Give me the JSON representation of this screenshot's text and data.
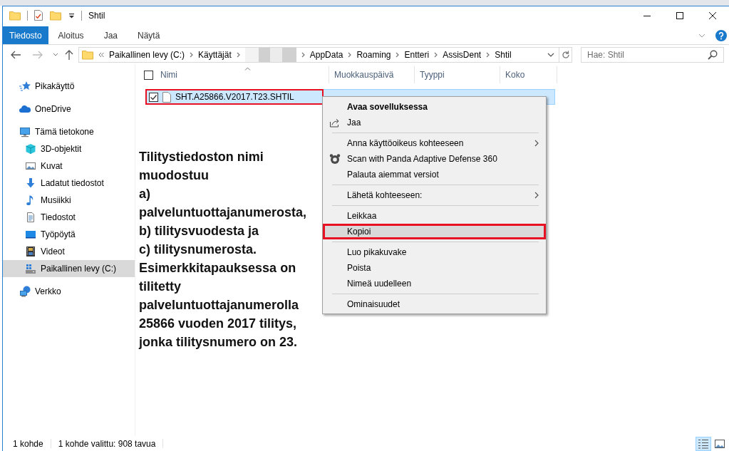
{
  "window": {
    "title": "Shtil"
  },
  "ribbon_tabs": [
    {
      "label": "Tiedosto",
      "kind": "file"
    },
    {
      "label": "Aloitus",
      "kind": "tab"
    },
    {
      "label": "Jaa",
      "kind": "tab"
    },
    {
      "label": "Näytä",
      "kind": "tab"
    }
  ],
  "address_bar": {
    "crumbs": [
      {
        "kind": "text",
        "label": "Paikallinen levy (C:)"
      },
      {
        "kind": "text",
        "label": "Käyttäjät"
      },
      {
        "kind": "redacted"
      },
      {
        "kind": "text",
        "label": "AppData"
      },
      {
        "kind": "text",
        "label": "Roaming"
      },
      {
        "kind": "text",
        "label": "Entteri"
      },
      {
        "kind": "text",
        "label": "AssisDent"
      },
      {
        "kind": "text",
        "label": "Shtil"
      }
    ]
  },
  "search": {
    "placeholder": "Hae: Shtil"
  },
  "sidebar": {
    "items": [
      {
        "label": "Pikakäyttö",
        "kind": "quick-access",
        "selected": false
      },
      {
        "label": "OneDrive",
        "kind": "cloud",
        "selected": false
      },
      {
        "label": "Tämä tietokone",
        "kind": "computer",
        "selected": false,
        "children": [
          {
            "label": "3D-objektit",
            "kind": "objects",
            "selected": false
          },
          {
            "label": "Kuvat",
            "kind": "pictures",
            "selected": false
          },
          {
            "label": "Ladatut tiedostot",
            "kind": "downloads",
            "selected": false
          },
          {
            "label": "Musiikki",
            "kind": "music",
            "selected": false
          },
          {
            "label": "Tiedostot",
            "kind": "documents",
            "selected": false
          },
          {
            "label": "Työpöytä",
            "kind": "desktop",
            "selected": false
          },
          {
            "label": "Videot",
            "kind": "videos",
            "selected": false
          },
          {
            "label": "Paikallinen levy (C:)",
            "kind": "drive",
            "selected": true
          }
        ]
      },
      {
        "label": "Verkko",
        "kind": "network",
        "selected": false
      }
    ]
  },
  "file_list": {
    "header_checked": false,
    "columns": [
      {
        "label": "Nimi",
        "sorted": true
      },
      {
        "label": "Muokkauspäivä",
        "sorted": false
      },
      {
        "label": "Tyyppi",
        "sorted": false
      },
      {
        "label": "Koko",
        "sorted": false
      }
    ],
    "rows": [
      {
        "name": "SHT.A25866.V2017.T23.SHTIL",
        "checked": true,
        "selected": true,
        "annotated": true
      }
    ]
  },
  "annotation": {
    "lines": [
      "Tilitystiedoston nimi",
      "muodostuu",
      "a)",
      "palveluntuottajanumerosta,",
      "b) tilitysvuodesta ja",
      "c) tilitysnumerosta.",
      "Esimerkkitapauksessa on",
      "tilitetty",
      "palveluntuottajanumerolla",
      "25866 vuoden 2017 tilitys,",
      "jonka tilitysnumero on 23."
    ]
  },
  "context_menu": {
    "items": [
      {
        "label": "Avaa sovelluksessa",
        "kind": "default",
        "selected": false,
        "annotated": false
      },
      {
        "label": "Jaa",
        "kind": "share",
        "selected": false,
        "annotated": false
      },
      {
        "kind": "separator"
      },
      {
        "label": "Anna käyttöoikeus kohteeseen",
        "kind": "submenu",
        "selected": false,
        "annotated": false
      },
      {
        "label": "Scan with Panda Adaptive Defense 360",
        "kind": "scan",
        "selected": false,
        "annotated": false
      },
      {
        "label": "Palauta aiemmat versiot",
        "kind": "item",
        "selected": false,
        "annotated": false
      },
      {
        "kind": "separator"
      },
      {
        "label": "Lähetä kohteeseen:",
        "kind": "submenu",
        "selected": false,
        "annotated": false
      },
      {
        "kind": "separator"
      },
      {
        "label": "Leikkaa",
        "kind": "item",
        "selected": false,
        "annotated": false
      },
      {
        "label": "Kopioi",
        "kind": "item",
        "selected": true,
        "annotated": true
      },
      {
        "kind": "separator"
      },
      {
        "label": "Luo pikakuvake",
        "kind": "item",
        "selected": false,
        "annotated": false
      },
      {
        "label": "Poista",
        "kind": "item",
        "selected": false,
        "annotated": false
      },
      {
        "label": "Nimeä uudelleen",
        "kind": "item",
        "selected": false,
        "annotated": false
      },
      {
        "kind": "separator"
      },
      {
        "label": "Ominaisuudet",
        "kind": "item",
        "selected": false,
        "annotated": false
      }
    ]
  },
  "status_bar": {
    "items": [
      "1 kohde",
      "1 kohde valittu: 908 tavua"
    ],
    "views": [
      {
        "kind": "details",
        "selected": true
      },
      {
        "kind": "large-icons",
        "selected": false
      }
    ]
  }
}
